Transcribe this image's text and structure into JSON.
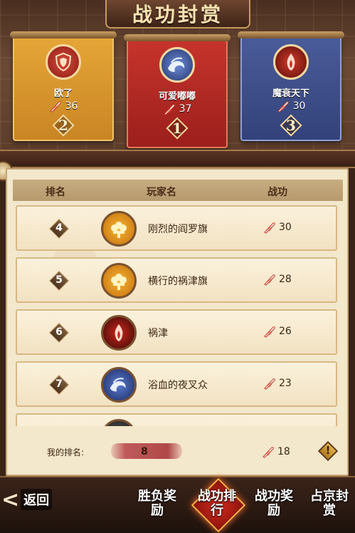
{
  "title": "战功封赏",
  "podium": [
    {
      "rank": "1",
      "name": "可爱嘟嘟",
      "score": "37",
      "emblem": "wave-emblem-icon"
    },
    {
      "rank": "2",
      "name": "欧了",
      "score": "36",
      "emblem": "shield-emblem-icon"
    },
    {
      "rank": "3",
      "name": "魔衰天下",
      "score": "30",
      "emblem": "flame-emblem-icon"
    }
  ],
  "table": {
    "headers": {
      "rank": "排名",
      "player": "玩家名",
      "merit": "战功"
    },
    "rows": [
      {
        "rank": "4",
        "name": "刚烈的阎罗旗",
        "score": "30",
        "avatar": "gold-flower-icon"
      },
      {
        "rank": "5",
        "name": "横行的祸津旗",
        "score": "28",
        "avatar": "gold-flower-icon"
      },
      {
        "rank": "6",
        "name": "祸津",
        "score": "26",
        "avatar": "red-flame-icon"
      },
      {
        "rank": "7",
        "name": "浴血的夜叉众",
        "score": "23",
        "avatar": "blue-wave-icon"
      }
    ]
  },
  "my_rank": {
    "label": "我的排名:",
    "rank": "8",
    "score": "18",
    "info_symbol": "!"
  },
  "nav": {
    "back": "返回",
    "tabs": [
      "胜负奖励",
      "战功排行",
      "战功奖励",
      "占京封赏"
    ],
    "active": "战功排行"
  },
  "colors": {
    "gold": "#e6a637",
    "red": "#c7342c",
    "blue": "#4a5c9a",
    "parchment": "#f3e7cc"
  }
}
